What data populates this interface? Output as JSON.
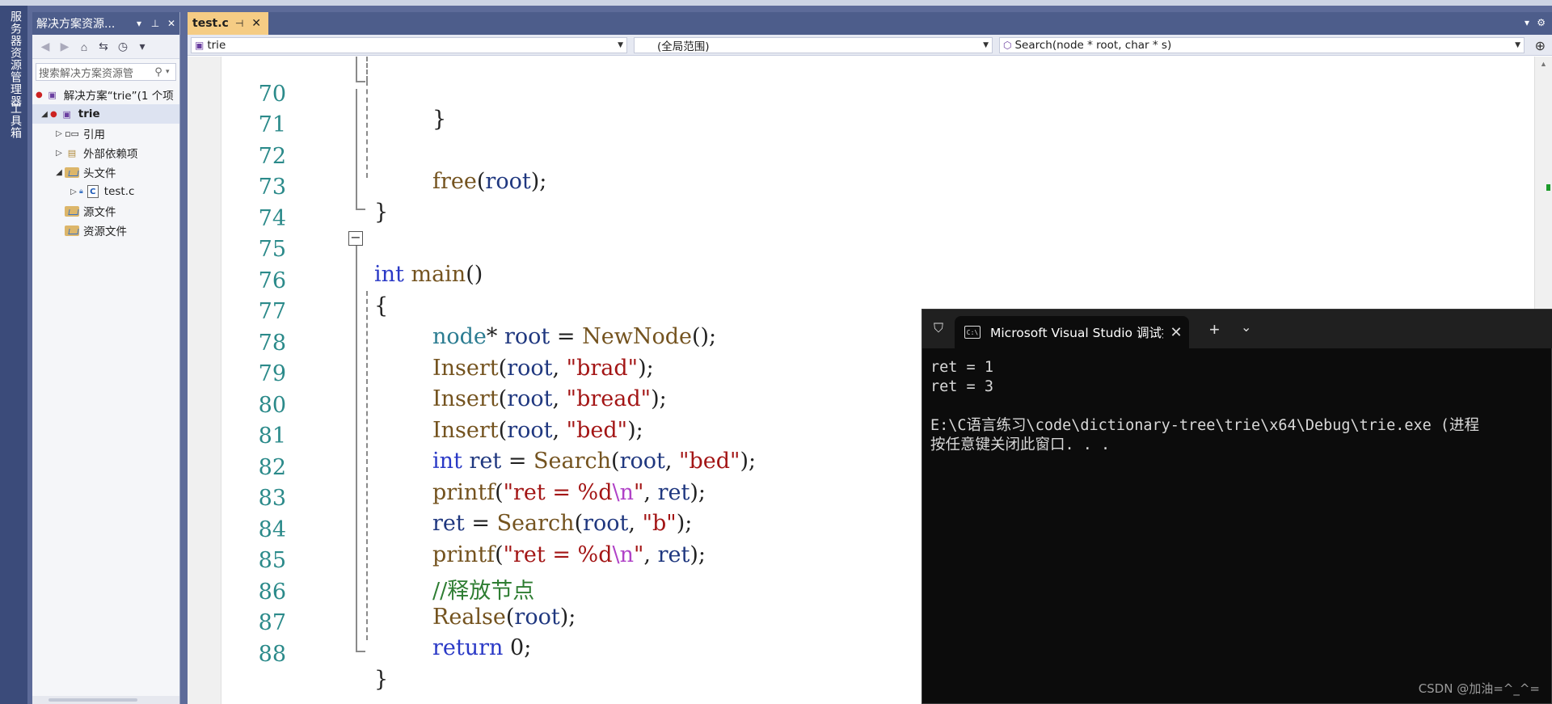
{
  "left_rail": {
    "tabs": [
      "服务器资源管理器",
      "工具箱"
    ]
  },
  "solution_explorer": {
    "title": "解决方案资源...",
    "search_placeholder": "搜索解决方案资源管",
    "tree": [
      {
        "label": "解决方案“trie”(1 个项",
        "level": 0,
        "expand": "",
        "icon": "solution-icon"
      },
      {
        "label": "trie",
        "level": 1,
        "expand": "◢",
        "icon": "project-icon",
        "bold": true
      },
      {
        "label": "引用",
        "level": 2,
        "expand": "▷",
        "icon": "references-icon"
      },
      {
        "label": "外部依赖项",
        "level": 2,
        "expand": "▷",
        "icon": "external-deps-icon"
      },
      {
        "label": "头文件",
        "level": 2,
        "expand": "◢",
        "icon": "folder-icon"
      },
      {
        "label": "test.c",
        "level": 3,
        "expand": "▷",
        "icon": "c-file-icon"
      },
      {
        "label": "源文件",
        "level": 2,
        "expand": "",
        "icon": "folder-icon"
      },
      {
        "label": "资源文件",
        "level": 2,
        "expand": "",
        "icon": "folder-icon"
      }
    ]
  },
  "editor": {
    "tab": {
      "label": "test.c",
      "pin": "⊣",
      "close": "✕"
    },
    "nav": {
      "project": "trie",
      "scope": "(全局范围)",
      "member": "Search(node * root, char * s)"
    },
    "line_numbers": [
      "70",
      "71",
      "72",
      "73",
      "74",
      "75",
      "76",
      "77",
      "78",
      "79",
      "80",
      "81",
      "82",
      "83",
      "84",
      "85",
      "86",
      "87",
      "88"
    ]
  },
  "console": {
    "tab_title": "Microsoft Visual Studio 调试控制台",
    "output": "ret = 1\nret = 3\n\nE:\\C语言练习\\code\\dictionary-tree\\trie\\x64\\Debug\\trie.exe (进程\n按任意键关闭此窗口. . ."
  },
  "watermark": "CSDN @加油=^_^=",
  "colors": {
    "keyword": "#2a39c6",
    "function": "#74531f",
    "string": "#a31515",
    "comment": "#2e7d32",
    "tab_active": "#f5cc84",
    "chrome": "#4d5d8b"
  }
}
